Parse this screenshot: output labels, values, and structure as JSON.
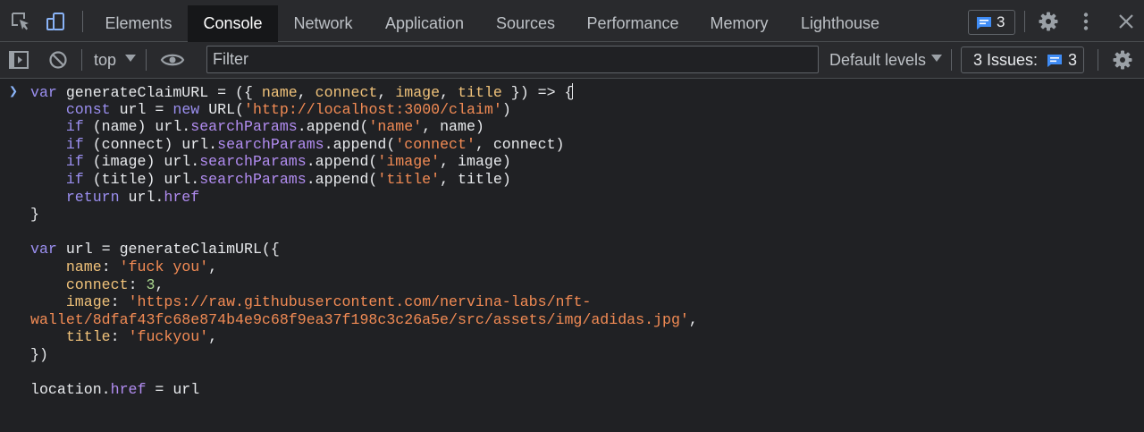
{
  "tabs": [
    {
      "label": "Elements",
      "active": false
    },
    {
      "label": "Console",
      "active": true
    },
    {
      "label": "Network",
      "active": false
    },
    {
      "label": "Application",
      "active": false
    },
    {
      "label": "Sources",
      "active": false
    },
    {
      "label": "Performance",
      "active": false
    },
    {
      "label": "Memory",
      "active": false
    },
    {
      "label": "Lighthouse",
      "active": false
    }
  ],
  "tabbar": {
    "message_count": "3"
  },
  "toolbar": {
    "context": "top",
    "filter_placeholder": "Filter",
    "levels": "Default levels",
    "issues_label": "3 Issues:",
    "issues_count": "3"
  },
  "console": {
    "prompt": "❯",
    "lines": [
      [
        [
          "kw",
          "var"
        ],
        [
          "p",
          " generateClaimURL = ({ "
        ],
        [
          "prop",
          "name"
        ],
        [
          "p",
          ", "
        ],
        [
          "prop",
          "connect"
        ],
        [
          "p",
          ", "
        ],
        [
          "prop",
          "image"
        ],
        [
          "p",
          ", "
        ],
        [
          "prop",
          "title"
        ],
        [
          "p",
          " }) => {"
        ]
      ],
      [
        [
          "p",
          "    "
        ],
        [
          "kw",
          "const"
        ],
        [
          "p",
          " url = "
        ],
        [
          "kw",
          "new"
        ],
        [
          "p",
          " URL("
        ],
        [
          "str",
          "'http://localhost:3000/claim'"
        ],
        [
          "p",
          ")"
        ]
      ],
      [
        [
          "p",
          "    "
        ],
        [
          "kw",
          "if"
        ],
        [
          "p",
          " (name) url."
        ],
        [
          "mth",
          "searchParams"
        ],
        [
          "p",
          ".append("
        ],
        [
          "str",
          "'name'"
        ],
        [
          "p",
          ", name)"
        ]
      ],
      [
        [
          "p",
          "    "
        ],
        [
          "kw",
          "if"
        ],
        [
          "p",
          " (connect) url."
        ],
        [
          "mth",
          "searchParams"
        ],
        [
          "p",
          ".append("
        ],
        [
          "str",
          "'connect'"
        ],
        [
          "p",
          ", connect)"
        ]
      ],
      [
        [
          "p",
          "    "
        ],
        [
          "kw",
          "if"
        ],
        [
          "p",
          " (image) url."
        ],
        [
          "mth",
          "searchParams"
        ],
        [
          "p",
          ".append("
        ],
        [
          "str",
          "'image'"
        ],
        [
          "p",
          ", image)"
        ]
      ],
      [
        [
          "p",
          "    "
        ],
        [
          "kw",
          "if"
        ],
        [
          "p",
          " (title) url."
        ],
        [
          "mth",
          "searchParams"
        ],
        [
          "p",
          ".append("
        ],
        [
          "str",
          "'title'"
        ],
        [
          "p",
          ", title)"
        ]
      ],
      [
        [
          "p",
          "    "
        ],
        [
          "kw",
          "return"
        ],
        [
          "p",
          " url."
        ],
        [
          "mth",
          "href"
        ]
      ],
      [
        [
          "p",
          "}"
        ]
      ],
      [
        [
          "p",
          ""
        ]
      ],
      [
        [
          "kw",
          "var"
        ],
        [
          "p",
          " url = generateClaimURL({"
        ]
      ],
      [
        [
          "p",
          "    "
        ],
        [
          "prop",
          "name"
        ],
        [
          "p",
          ": "
        ],
        [
          "str",
          "'fuck you'"
        ],
        [
          "p",
          ","
        ]
      ],
      [
        [
          "p",
          "    "
        ],
        [
          "prop",
          "connect"
        ],
        [
          "p",
          ": "
        ],
        [
          "num",
          "3"
        ],
        [
          "p",
          ","
        ]
      ],
      [
        [
          "p",
          "    "
        ],
        [
          "prop",
          "image"
        ],
        [
          "p",
          ": "
        ],
        [
          "str",
          "'https://raw.githubusercontent.com/nervina-labs/nft-"
        ]
      ],
      [
        [
          "str",
          "wallet/8dfaf43fc68e874b4e9c68f9ea37f198c3c26a5e/src/assets/img/adidas.jpg'"
        ],
        [
          "p",
          ","
        ]
      ],
      [
        [
          "p",
          "    "
        ],
        [
          "prop",
          "title"
        ],
        [
          "p",
          ": "
        ],
        [
          "str",
          "'fuckyou'"
        ],
        [
          "p",
          ","
        ]
      ],
      [
        [
          "p",
          "})"
        ]
      ],
      [
        [
          "p",
          ""
        ]
      ],
      [
        [
          "p",
          "location."
        ],
        [
          "mth",
          "href"
        ],
        [
          "p",
          " = url"
        ]
      ]
    ]
  }
}
